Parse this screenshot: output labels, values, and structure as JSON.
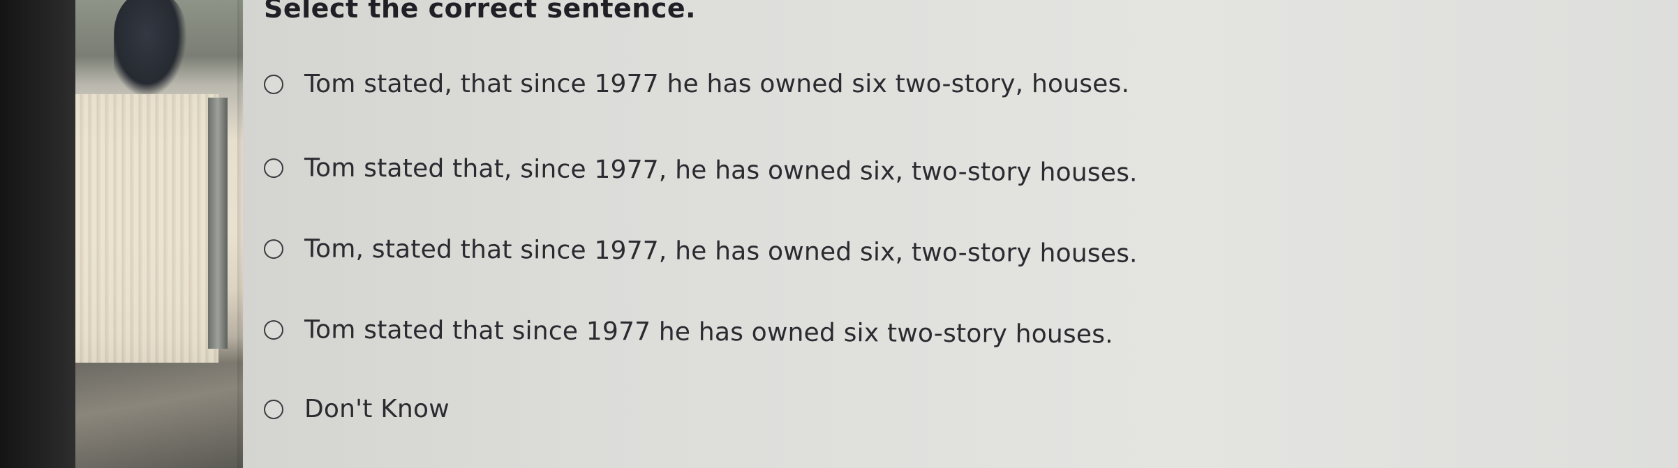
{
  "question": {
    "title": "Select the correct sentence."
  },
  "options": [
    {
      "label": "Tom stated, that since 1977 he has owned six two-story, houses.",
      "selected": false
    },
    {
      "label": "Tom stated that, since 1977, he has owned six, two-story houses.",
      "selected": false
    },
    {
      "label": "Tom, stated that since 1977, he has owned six, two-story houses.",
      "selected": false
    },
    {
      "label": "Tom stated that since 1977 he has owned six two-story houses.",
      "selected": false
    },
    {
      "label": "Don't Know",
      "selected": false
    }
  ],
  "colors": {
    "text": "#2a2a30",
    "title": "#1f1f25",
    "background": "#dcdcd9"
  },
  "icons": {
    "option_marker": "radio-circle"
  }
}
